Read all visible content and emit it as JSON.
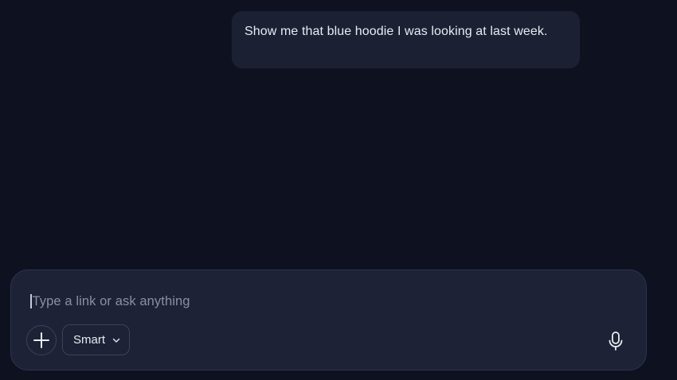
{
  "conversation": {
    "messages": [
      {
        "role": "user",
        "text": "Show me that blue hoodie I was looking at last week."
      }
    ]
  },
  "composer": {
    "placeholder": "Type a link or ask anything",
    "mode_label": "Smart",
    "icons": {
      "add": "plus-icon",
      "mode_dropdown": "chevron-down-icon",
      "voice": "microphone-icon"
    }
  },
  "colors": {
    "background": "#0e1220",
    "bubble": "#1b2133",
    "composer": "#1d2236",
    "border": "#3a4260",
    "text": "#e8ebf2",
    "placeholder": "#8a90a3"
  }
}
